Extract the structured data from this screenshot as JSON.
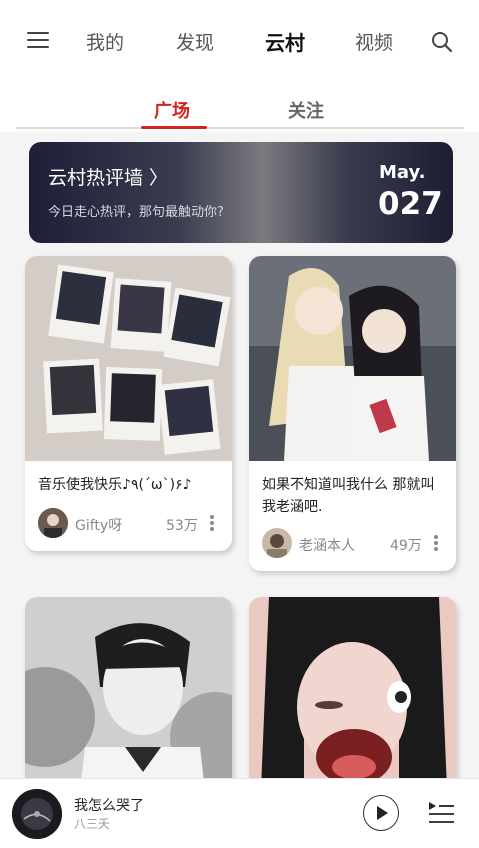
{
  "nav": {
    "tabs": [
      "我的",
      "发现",
      "云村",
      "视频"
    ],
    "active_tab": "云村"
  },
  "subtabs": {
    "items": [
      "广场",
      "关注"
    ],
    "active": "广场"
  },
  "banner": {
    "title": "云村热评墙 〉",
    "subtitle": "今日走心热评，那句最触动你?",
    "month": "May.",
    "day": "027"
  },
  "cards": [
    {
      "text": "音乐使我快乐♪٩(´ω`)۶♪",
      "user": "Gifty呀",
      "likes": "53万"
    },
    {
      "text": "如果不知道叫我什么 那就叫我老涵吧.",
      "user": "老涵本人",
      "likes": "49万"
    }
  ],
  "player": {
    "title": "我怎么哭了",
    "artist": "八三夭"
  },
  "colors": {
    "accent": "#d3231e",
    "banner_dark": "#1c1f38"
  }
}
